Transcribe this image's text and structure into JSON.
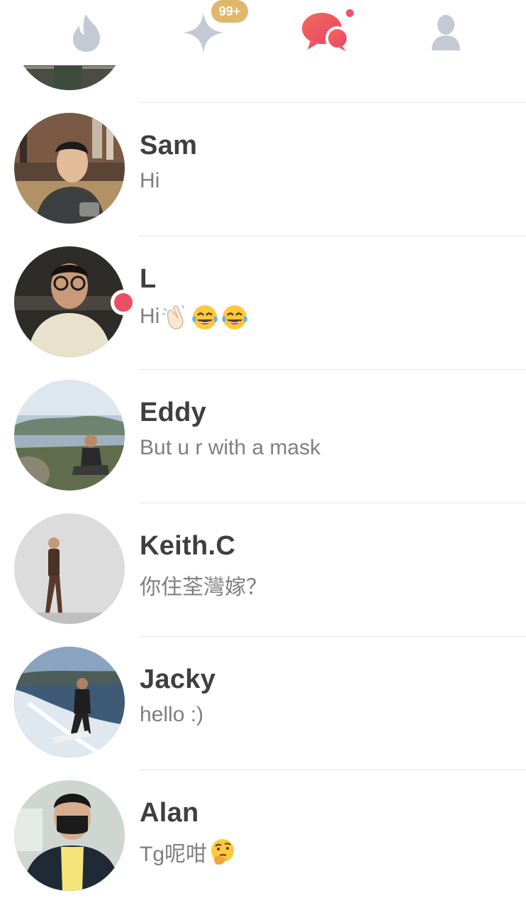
{
  "tabbar": {
    "tabs": [
      {
        "icon": "flame-icon"
      },
      {
        "icon": "sparkle-icon",
        "badge": "99+"
      },
      {
        "icon": "chat-bubbles-icon",
        "active": true
      },
      {
        "icon": "profile-icon"
      }
    ],
    "colors": {
      "inactive": "#c5c9d3",
      "active": "#ee5467",
      "badge": "#e0b76a"
    }
  },
  "conversations": [
    {
      "name": "Sam",
      "message": "Hi",
      "emojis": []
    },
    {
      "name": "L",
      "message": "Hi",
      "emojis": [
        "waving-hand-emoji",
        "tears-of-joy-emoji",
        "tears-of-joy-emoji"
      ],
      "unread": true
    },
    {
      "name": "Eddy",
      "message": "But u r with a mask",
      "emojis": []
    },
    {
      "name": "Keith.C",
      "message": "你住荃灣嫁？",
      "emojis": []
    },
    {
      "name": "Jacky",
      "message": "hello :)",
      "emojis": []
    },
    {
      "name": "Alan",
      "message": "Tg呢咁",
      "emojis": [
        "thinking-face-emoji"
      ]
    }
  ]
}
